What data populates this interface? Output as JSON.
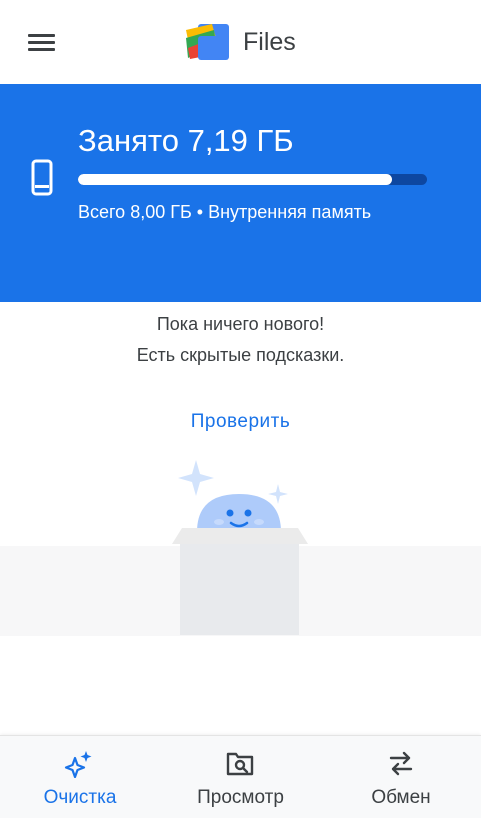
{
  "app": {
    "title": "Files"
  },
  "header": {
    "menu_icon": "hamburger-menu-icon",
    "logo_icon": "files-logo-icon"
  },
  "storage": {
    "used_label": "Занято 7,19 ГБ",
    "total_label": "Всего 8,00 ГБ • Внутренняя память",
    "used_gb": 7.19,
    "total_gb": 8.0,
    "icon": "smartphone-icon"
  },
  "empty_state": {
    "line1": "Пока ничего нового!",
    "line2": "Есть скрытые подсказки.",
    "action_label": "Проверить",
    "illustration": "happy-box-illustration"
  },
  "bottom_nav": {
    "items": [
      {
        "label": "Очистка",
        "icon": "sparkle-clean-icon",
        "active": true
      },
      {
        "label": "Просмотр",
        "icon": "folder-search-icon",
        "active": false
      },
      {
        "label": "Обмен",
        "icon": "swap-arrows-icon",
        "active": false
      }
    ]
  },
  "colors": {
    "primary": "#1a73e8",
    "bar_track": "#0d47a1",
    "text": "#3c4043",
    "logo_yellow": "#fbbc04",
    "logo_green": "#34a853",
    "logo_red": "#ea4335",
    "logo_blue": "#4285f4"
  }
}
